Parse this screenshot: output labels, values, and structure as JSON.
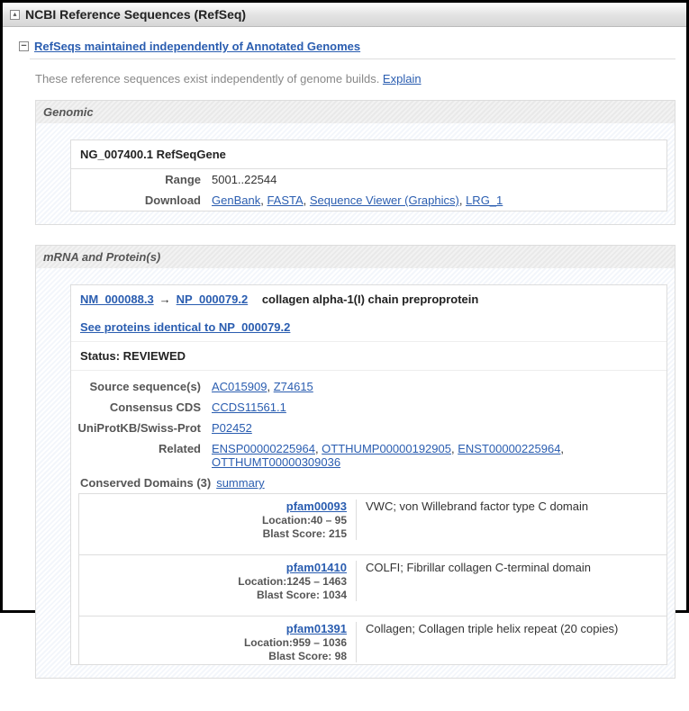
{
  "panel": {
    "title": "NCBI Reference Sequences (RefSeq)"
  },
  "subheading": "RefSeqs maintained independently of Annotated Genomes",
  "intro": {
    "text": "These reference sequences exist independently of genome builds. ",
    "explain": "Explain"
  },
  "genomic": {
    "title": "Genomic",
    "record_header": "NG_007400.1 RefSeqGene",
    "range_label": "Range",
    "range_value": "5001..22544",
    "download_label": "Download",
    "download": {
      "genbank": "GenBank",
      "fasta": "FASTA",
      "seqviewer": "Sequence Viewer (Graphics)",
      "lrg": "LRG_1"
    }
  },
  "mrna": {
    "title": "mRNA and Protein(s)",
    "nm": "NM_000088.3",
    "arrow": "→",
    "np": "NP_000079.2",
    "desc": "collagen alpha-1(I) chain preproprotein",
    "identical": "See proteins identical to NP_000079.2",
    "status_label": "Status: ",
    "status_value": "REVIEWED",
    "source_label": "Source sequence(s)",
    "sources": {
      "s1": "AC015909",
      "s2": "Z74615"
    },
    "ccds_label": "Consensus CDS",
    "ccds": "CCDS11561.1",
    "uniprot_label": "UniProtKB/Swiss-Prot",
    "uniprot": "P02452",
    "related_label": "Related",
    "related": {
      "r1": "ENSP00000225964",
      "r2": "OTTHUMP00000192905",
      "r3": "ENST00000225964",
      "r4": "OTTHUMT00000309036"
    },
    "cd_label": "Conserved Domains (3) ",
    "cd_summary": "summary",
    "domains": [
      {
        "pfam": "pfam00093",
        "location": "Location:40 – 95",
        "blast": "Blast Score: 215",
        "desc": "VWC; von Willebrand factor type C domain"
      },
      {
        "pfam": "pfam01410",
        "location": "Location:1245 – 1463",
        "blast": "Blast Score: 1034",
        "desc": "COLFI; Fibrillar collagen C-terminal domain"
      },
      {
        "pfam": "pfam01391",
        "location": "Location:959 – 1036",
        "blast": "Blast Score: 98",
        "desc": "Collagen; Collagen triple helix repeat (20 copies)"
      }
    ]
  }
}
